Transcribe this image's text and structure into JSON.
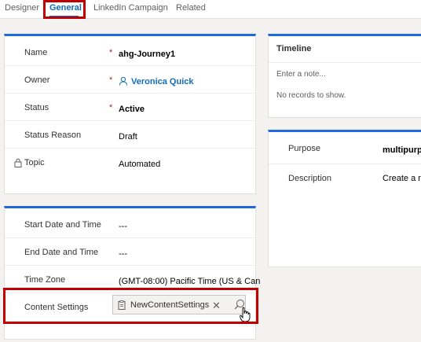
{
  "tabs": [
    {
      "label": "Designer"
    },
    {
      "label": "General"
    },
    {
      "label": "LinkedIn Campaign"
    },
    {
      "label": "Related"
    }
  ],
  "general": {
    "name": {
      "label": "Name",
      "value": "ahg-Journey1"
    },
    "owner": {
      "label": "Owner",
      "value": "Veronica Quick"
    },
    "status": {
      "label": "Status",
      "value": "Active"
    },
    "status_reason": {
      "label": "Status Reason",
      "value": "Draft"
    },
    "topic": {
      "label": "Topic",
      "value": "Automated"
    },
    "required_mark": "*"
  },
  "schedule": {
    "start": {
      "label": "Start Date and Time",
      "value": "---"
    },
    "end": {
      "label": "End Date and Time",
      "value": "---"
    },
    "timezone": {
      "label": "Time Zone",
      "value": "(GMT-08:00) Pacific Time (US & Can"
    },
    "content_settings": {
      "label": "Content Settings",
      "value": "NewContentSettings"
    }
  },
  "timeline": {
    "title": "Timeline",
    "input_placeholder": "Enter a note...",
    "empty": "No records to show."
  },
  "details": {
    "purpose": {
      "label": "Purpose",
      "value": "multipurpo"
    },
    "description": {
      "label": "Description",
      "value": "Create a ne"
    }
  },
  "colors": {
    "accent": "#0f6cbd",
    "highlight": "#c00000",
    "required": "#a4262c"
  }
}
